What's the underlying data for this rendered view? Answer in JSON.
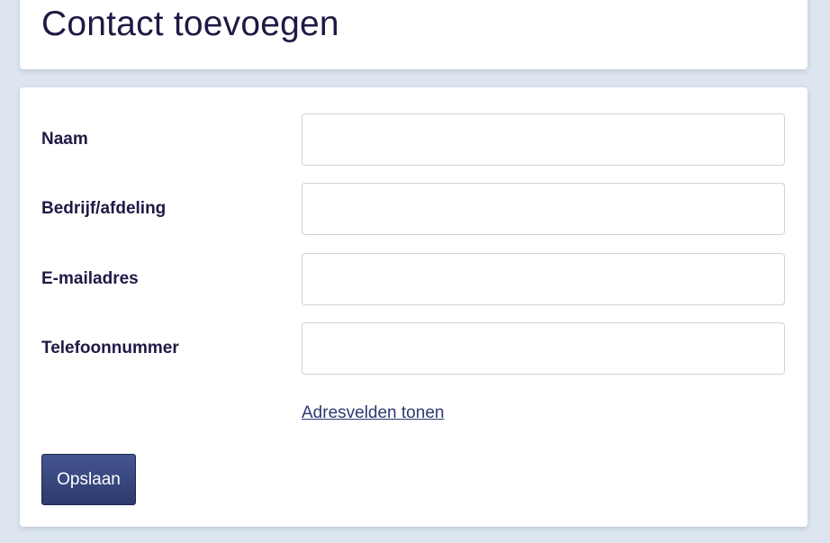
{
  "colors": {
    "page_background": "#dde6ef",
    "card_background": "#ffffff",
    "text": "#1e1a45",
    "link": "#2c3a72",
    "button_top": "#45558f",
    "button_bottom": "#2d3a6e",
    "input_border": "#cfd3d8"
  },
  "header": {
    "title": "Contact toevoegen"
  },
  "form": {
    "fields": [
      {
        "label": "Naam",
        "value": "",
        "placeholder": ""
      },
      {
        "label": "Bedrijf/afdeling",
        "value": "",
        "placeholder": ""
      },
      {
        "label": "E-mailadres",
        "value": "",
        "placeholder": ""
      },
      {
        "label": "Telefoonnummer",
        "value": "",
        "placeholder": ""
      }
    ],
    "address_link": "Adresvelden tonen",
    "save_label": "Opslaan"
  }
}
